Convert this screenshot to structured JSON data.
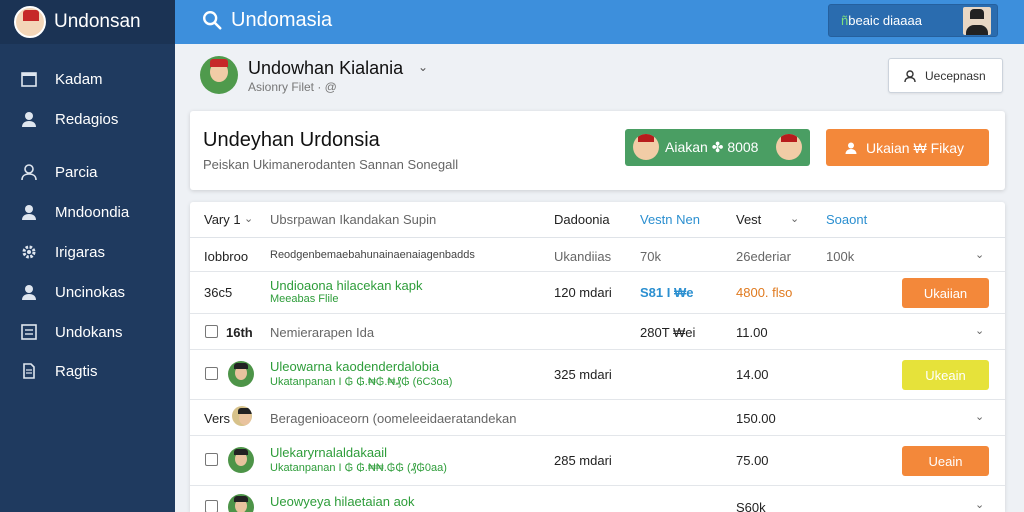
{
  "sidebar": {
    "brand": "Undonsan",
    "items": [
      {
        "label": "Kadam",
        "icon": "calendar-icon"
      },
      {
        "label": "Redagios",
        "icon": "user-icon"
      },
      {
        "label": "Parcia",
        "icon": "person-icon"
      },
      {
        "label": "Mndoondia",
        "icon": "user-icon"
      },
      {
        "label": "Irigaras",
        "icon": "gear-icon"
      },
      {
        "label": "Uncinokas",
        "icon": "user-icon"
      },
      {
        "label": "Undokans",
        "icon": "list-icon"
      },
      {
        "label": "Ragtis",
        "icon": "document-icon"
      }
    ]
  },
  "topbar": {
    "title": "Undomasia",
    "user_label_prefix": "ñ",
    "user_label": "beaic diaaaa"
  },
  "page_header": {
    "title": "Undowhan Kialania",
    "subtitle": "Asionry Filet · @",
    "button": "Uecepnasn"
  },
  "card": {
    "title": "Undeyhan Urdonsia",
    "subtitle": "Peiskan Ukimanerodanten Sannan Sonegall",
    "green_button": "Aiakan ✤ 8008",
    "orange_button": "Ukaian ₩ Fikay"
  },
  "table": {
    "headers": [
      "Vary 1",
      "Ubsrpawan Ikandakan Supin",
      "Dadoonia",
      "Vestn Nen",
      "Vest",
      "Soaont"
    ],
    "rows": [
      {
        "c1": "Iobbroo",
        "c2": "Reodgenbemaebahunainaenaiagenbadds",
        "c3": "Ukandiias",
        "c4": "70k",
        "c5": "26ederiar",
        "c6": "100k",
        "chevron": true
      },
      {
        "c1": "36c5",
        "c2": "Undioaona hilacekan kapk",
        "c2b": "Meeabas Flile",
        "c3": "120 mdari",
        "c4": "S81 I ₩e",
        "c5": "4800. flso",
        "action": "Ukaiian"
      },
      {
        "c1": "16th",
        "c2": "Nemierarapen Ida",
        "c4": "280T ₩ei",
        "c5": "11.00",
        "chevron": true
      },
      {
        "c2": "Uleowarna kaodenderdalobia",
        "c2b": "Ukatanpanan I ₲ ₲.₦₲.₦₰₲ (6C3oa)",
        "c3": "325 mdari",
        "c5": "14.00",
        "action": "Ukeain"
      },
      {
        "c1": "Vers",
        "c2": "Beragenioaceorn (oomeleeidaeratandekan",
        "c5": "150.00",
        "chevron": true
      },
      {
        "c2": "Ulekaryrnalaldakaail",
        "c2b": "Ukatanpanan I ₲ ₲.₦₦.₲₲ (₰₲0aa)",
        "c3": "285 mdari",
        "c5": "75.00",
        "action": "Ueain"
      },
      {
        "c2": "Ueowyeya hilaetaian aok",
        "c5": "S60k",
        "chevron": true
      }
    ]
  }
}
